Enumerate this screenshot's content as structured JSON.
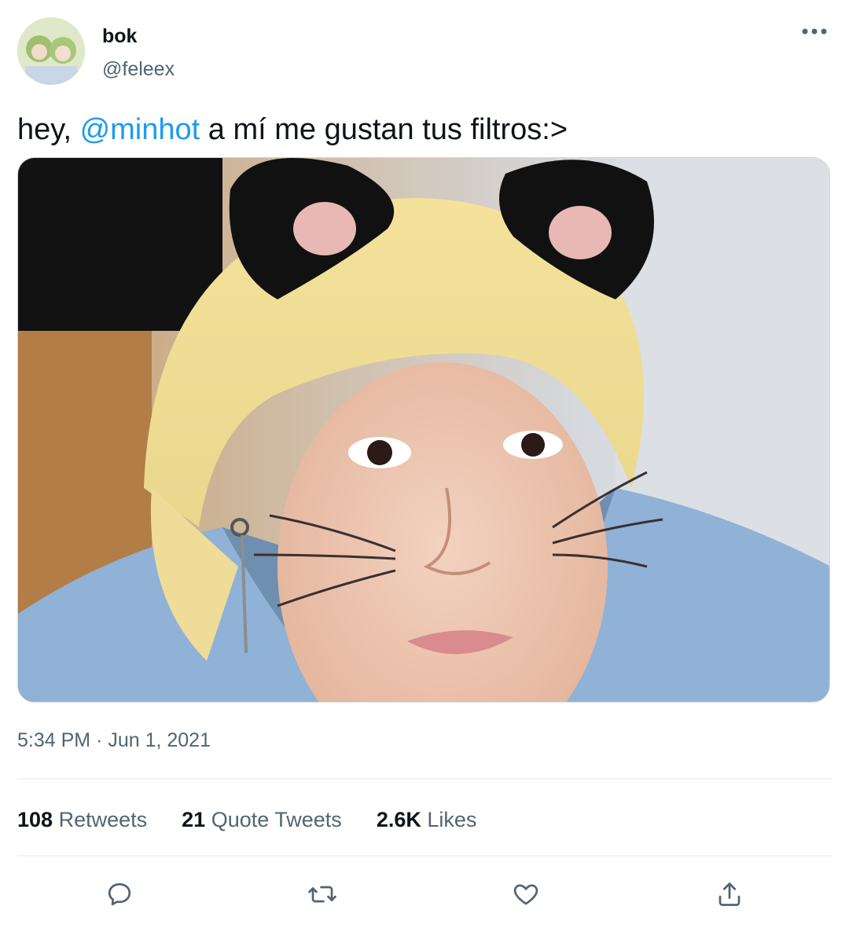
{
  "author": {
    "display_name": "bok",
    "handle": "@feleex",
    "avatar_icon": "user-avatar"
  },
  "tweet": {
    "text_before": "hey, ",
    "mention": "@minhot",
    "text_after": " a mí me gustan tus filtros:>",
    "media_icon": "photo-cat-filter-selfie",
    "timestamp": "5:34 PM · Jun 1, 2021"
  },
  "stats": [
    {
      "value": "108",
      "label": "Retweets"
    },
    {
      "value": "21",
      "label": "Quote Tweets"
    },
    {
      "value": "2.6K",
      "label": "Likes"
    }
  ],
  "actions": {
    "reply_icon": "reply-icon",
    "retweet_icon": "retweet-icon",
    "like_icon": "heart-icon",
    "share_icon": "share-icon"
  },
  "colors": {
    "mention": "#1d9bf0",
    "secondary_text": "#536471",
    "divider": "#eff3f4",
    "icon": "#536471"
  }
}
